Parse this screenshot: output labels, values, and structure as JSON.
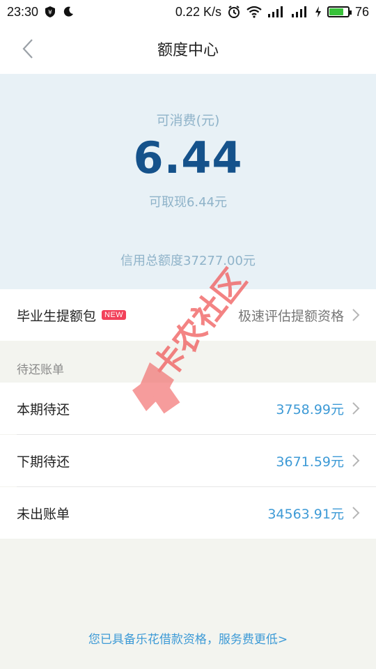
{
  "status_bar": {
    "time": "23:30",
    "speed": "0.22 K/s",
    "battery": "76",
    "battery_level": 0.76
  },
  "header": {
    "title": "额度中心"
  },
  "hero": {
    "available_label": "可消费(元)",
    "available_amount": "6.44",
    "withdraw_text": "可取现6.44元",
    "total_credit": "信用总额度37277.00元"
  },
  "graduate": {
    "label": "毕业生提额包",
    "badge": "NEW",
    "value": "极速评估提额资格"
  },
  "bills": {
    "section_label": "待还账单",
    "items": [
      {
        "label": "本期待还",
        "value": "3758.99元"
      },
      {
        "label": "下期待还",
        "value": "3671.59元"
      },
      {
        "label": "未出账单",
        "value": "34563.91元"
      }
    ]
  },
  "footer": {
    "link_text": "您已具备乐花借款资格，服务费更低>"
  },
  "watermark": {
    "text": "卡农社区"
  },
  "colors": {
    "accent": "#3d9ad6",
    "amount": "#15528b",
    "hero_bg": "#e8f1f6",
    "badge": "#f2415a",
    "watermark": "#f05a5a"
  }
}
